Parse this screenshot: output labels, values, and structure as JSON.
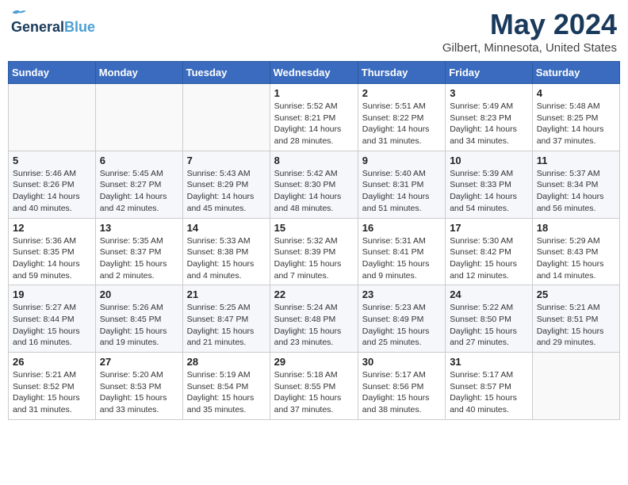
{
  "header": {
    "logo_general": "General",
    "logo_blue": "Blue",
    "month": "May 2024",
    "location": "Gilbert, Minnesota, United States"
  },
  "days_of_week": [
    "Sunday",
    "Monday",
    "Tuesday",
    "Wednesday",
    "Thursday",
    "Friday",
    "Saturday"
  ],
  "weeks": [
    [
      {
        "day": "",
        "info": ""
      },
      {
        "day": "",
        "info": ""
      },
      {
        "day": "",
        "info": ""
      },
      {
        "day": "1",
        "info": "Sunrise: 5:52 AM\nSunset: 8:21 PM\nDaylight: 14 hours\nand 28 minutes."
      },
      {
        "day": "2",
        "info": "Sunrise: 5:51 AM\nSunset: 8:22 PM\nDaylight: 14 hours\nand 31 minutes."
      },
      {
        "day": "3",
        "info": "Sunrise: 5:49 AM\nSunset: 8:23 PM\nDaylight: 14 hours\nand 34 minutes."
      },
      {
        "day": "4",
        "info": "Sunrise: 5:48 AM\nSunset: 8:25 PM\nDaylight: 14 hours\nand 37 minutes."
      }
    ],
    [
      {
        "day": "5",
        "info": "Sunrise: 5:46 AM\nSunset: 8:26 PM\nDaylight: 14 hours\nand 40 minutes."
      },
      {
        "day": "6",
        "info": "Sunrise: 5:45 AM\nSunset: 8:27 PM\nDaylight: 14 hours\nand 42 minutes."
      },
      {
        "day": "7",
        "info": "Sunrise: 5:43 AM\nSunset: 8:29 PM\nDaylight: 14 hours\nand 45 minutes."
      },
      {
        "day": "8",
        "info": "Sunrise: 5:42 AM\nSunset: 8:30 PM\nDaylight: 14 hours\nand 48 minutes."
      },
      {
        "day": "9",
        "info": "Sunrise: 5:40 AM\nSunset: 8:31 PM\nDaylight: 14 hours\nand 51 minutes."
      },
      {
        "day": "10",
        "info": "Sunrise: 5:39 AM\nSunset: 8:33 PM\nDaylight: 14 hours\nand 54 minutes."
      },
      {
        "day": "11",
        "info": "Sunrise: 5:37 AM\nSunset: 8:34 PM\nDaylight: 14 hours\nand 56 minutes."
      }
    ],
    [
      {
        "day": "12",
        "info": "Sunrise: 5:36 AM\nSunset: 8:35 PM\nDaylight: 14 hours\nand 59 minutes."
      },
      {
        "day": "13",
        "info": "Sunrise: 5:35 AM\nSunset: 8:37 PM\nDaylight: 15 hours\nand 2 minutes."
      },
      {
        "day": "14",
        "info": "Sunrise: 5:33 AM\nSunset: 8:38 PM\nDaylight: 15 hours\nand 4 minutes."
      },
      {
        "day": "15",
        "info": "Sunrise: 5:32 AM\nSunset: 8:39 PM\nDaylight: 15 hours\nand 7 minutes."
      },
      {
        "day": "16",
        "info": "Sunrise: 5:31 AM\nSunset: 8:41 PM\nDaylight: 15 hours\nand 9 minutes."
      },
      {
        "day": "17",
        "info": "Sunrise: 5:30 AM\nSunset: 8:42 PM\nDaylight: 15 hours\nand 12 minutes."
      },
      {
        "day": "18",
        "info": "Sunrise: 5:29 AM\nSunset: 8:43 PM\nDaylight: 15 hours\nand 14 minutes."
      }
    ],
    [
      {
        "day": "19",
        "info": "Sunrise: 5:27 AM\nSunset: 8:44 PM\nDaylight: 15 hours\nand 16 minutes."
      },
      {
        "day": "20",
        "info": "Sunrise: 5:26 AM\nSunset: 8:45 PM\nDaylight: 15 hours\nand 19 minutes."
      },
      {
        "day": "21",
        "info": "Sunrise: 5:25 AM\nSunset: 8:47 PM\nDaylight: 15 hours\nand 21 minutes."
      },
      {
        "day": "22",
        "info": "Sunrise: 5:24 AM\nSunset: 8:48 PM\nDaylight: 15 hours\nand 23 minutes."
      },
      {
        "day": "23",
        "info": "Sunrise: 5:23 AM\nSunset: 8:49 PM\nDaylight: 15 hours\nand 25 minutes."
      },
      {
        "day": "24",
        "info": "Sunrise: 5:22 AM\nSunset: 8:50 PM\nDaylight: 15 hours\nand 27 minutes."
      },
      {
        "day": "25",
        "info": "Sunrise: 5:21 AM\nSunset: 8:51 PM\nDaylight: 15 hours\nand 29 minutes."
      }
    ],
    [
      {
        "day": "26",
        "info": "Sunrise: 5:21 AM\nSunset: 8:52 PM\nDaylight: 15 hours\nand 31 minutes."
      },
      {
        "day": "27",
        "info": "Sunrise: 5:20 AM\nSunset: 8:53 PM\nDaylight: 15 hours\nand 33 minutes."
      },
      {
        "day": "28",
        "info": "Sunrise: 5:19 AM\nSunset: 8:54 PM\nDaylight: 15 hours\nand 35 minutes."
      },
      {
        "day": "29",
        "info": "Sunrise: 5:18 AM\nSunset: 8:55 PM\nDaylight: 15 hours\nand 37 minutes."
      },
      {
        "day": "30",
        "info": "Sunrise: 5:17 AM\nSunset: 8:56 PM\nDaylight: 15 hours\nand 38 minutes."
      },
      {
        "day": "31",
        "info": "Sunrise: 5:17 AM\nSunset: 8:57 PM\nDaylight: 15 hours\nand 40 minutes."
      },
      {
        "day": "",
        "info": ""
      }
    ]
  ]
}
